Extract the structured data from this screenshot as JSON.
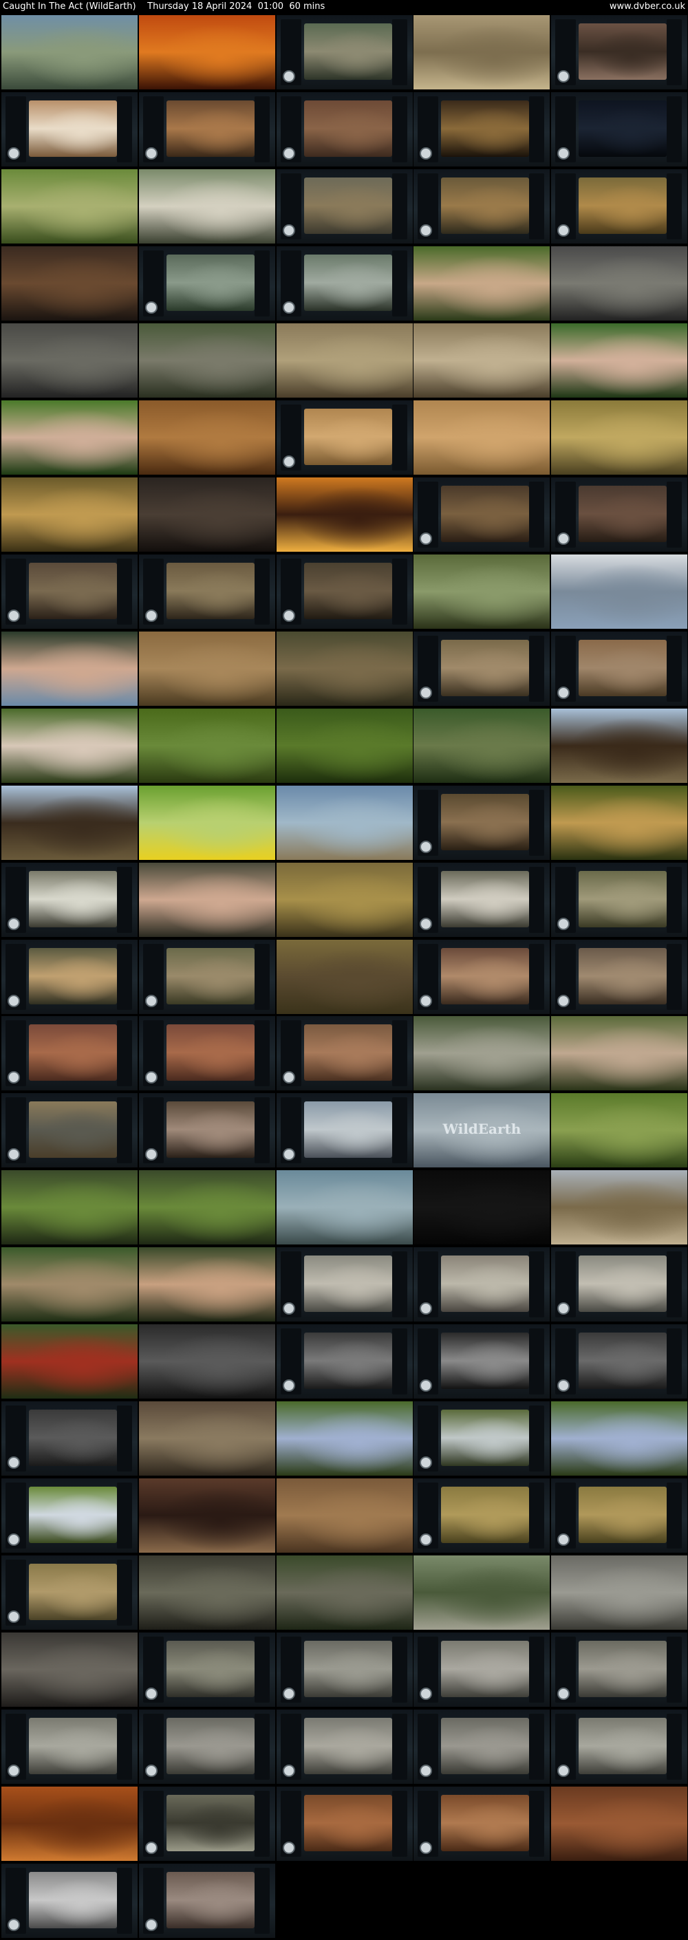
{
  "header": {
    "title": "Caught In The Act (WildEarth)    Thursday 18 April 2024  01:00  60 mins",
    "site": "www.dvber.co.uk"
  },
  "thumbnails": [
    {
      "kind": "photo",
      "palette": [
        "#6f8fa6",
        "#8a9a7a",
        "#3a4a3a"
      ],
      "caption": ""
    },
    {
      "kind": "photo",
      "palette": [
        "#c04a10",
        "#e07a20",
        "#3a1205"
      ],
      "caption": ""
    },
    {
      "kind": "ui",
      "palette": [
        "#5a6a52",
        "#8d8a72",
        "#2d3428"
      ],
      "caption": ""
    },
    {
      "kind": "photo",
      "palette": [
        "#a89774",
        "#7d6e4f",
        "#c5b48c"
      ],
      "caption": ""
    },
    {
      "kind": "ui",
      "palette": [
        "#6b5244",
        "#3a2d24",
        "#8a7060"
      ],
      "caption": ""
    },
    {
      "kind": "ui",
      "palette": [
        "#b8906a",
        "#e9dcc8",
        "#7a5a3a"
      ],
      "caption": ""
    },
    {
      "kind": "ui",
      "palette": [
        "#6a4a30",
        "#a9784a",
        "#3a2818"
      ],
      "caption": ""
    },
    {
      "kind": "ui",
      "palette": [
        "#6d4a36",
        "#8a6448",
        "#3d2a1f"
      ],
      "caption": ""
    },
    {
      "kind": "ui",
      "palette": [
        "#3a2a1a",
        "#8a6a3a",
        "#1a120a"
      ],
      "caption": ""
    },
    {
      "kind": "ui",
      "palette": [
        "#0e1420",
        "#1b2433",
        "#05080c"
      ],
      "caption": ""
    },
    {
      "kind": "photo",
      "palette": [
        "#6a8a3a",
        "#a8b070",
        "#384d1c"
      ],
      "caption": ""
    },
    {
      "kind": "photo",
      "palette": [
        "#7a8a6a",
        "#d4d0c0",
        "#3a4030"
      ],
      "caption": ""
    },
    {
      "kind": "ui",
      "palette": [
        "#6d6a58",
        "#8a7a5a",
        "#3d3a2e"
      ],
      "caption": ""
    },
    {
      "kind": "ui",
      "palette": [
        "#6a5a3a",
        "#9a7a4a",
        "#2e2a1c"
      ],
      "caption": ""
    },
    {
      "kind": "ui",
      "palette": [
        "#7a6a3a",
        "#b08a4a",
        "#4a3a1a"
      ],
      "caption": ""
    },
    {
      "kind": "photo",
      "palette": [
        "#3a2a20",
        "#6a4a30",
        "#1a1410"
      ],
      "caption": ""
    },
    {
      "kind": "ui",
      "palette": [
        "#5a6a5a",
        "#8a9a8a",
        "#2a3a2a"
      ],
      "caption": ""
    },
    {
      "kind": "ui",
      "palette": [
        "#6a7a6a",
        "#a0aaa0",
        "#2a3228"
      ],
      "caption": ""
    },
    {
      "kind": "photo",
      "palette": [
        "#4a6a2a",
        "#c8a888",
        "#2a3a18"
      ],
      "caption": ""
    },
    {
      "kind": "photo",
      "palette": [
        "#4a4a4a",
        "#7a7a72",
        "#222"
      ],
      "caption": ""
    },
    {
      "kind": "photo",
      "palette": [
        "#4a4a46",
        "#6a6a62",
        "#222"
      ],
      "caption": ""
    },
    {
      "kind": "photo",
      "palette": [
        "#4a5a3a",
        "#7a7a6a",
        "#2a3020"
      ],
      "caption": ""
    },
    {
      "kind": "photo",
      "palette": [
        "#8a7a5a",
        "#b0a07a",
        "#4a3e2a"
      ],
      "caption": ""
    },
    {
      "kind": "photo",
      "palette": [
        "#8a7a5a",
        "#c0b090",
        "#4a3e2a"
      ],
      "caption": ""
    },
    {
      "kind": "photo",
      "palette": [
        "#3a6a2a",
        "#d2b09a",
        "#1d3614"
      ],
      "caption": ""
    },
    {
      "kind": "photo",
      "palette": [
        "#4a7a2a",
        "#cfae98",
        "#1c3a12"
      ],
      "caption": ""
    },
    {
      "kind": "photo",
      "palette": [
        "#8a5a2a",
        "#b07a40",
        "#4a2a10"
      ],
      "caption": ""
    },
    {
      "kind": "ui",
      "palette": [
        "#b08650",
        "#d2a870",
        "#7a5a30"
      ],
      "caption": ""
    },
    {
      "kind": "photo",
      "palette": [
        "#b08650",
        "#d0a46c",
        "#7a5a30"
      ],
      "caption": ""
    },
    {
      "kind": "photo",
      "palette": [
        "#8a7a3a",
        "#c0a860",
        "#4a4020"
      ],
      "caption": ""
    },
    {
      "kind": "photo",
      "palette": [
        "#6a5a2a",
        "#c09a50",
        "#3a3014"
      ],
      "caption": ""
    },
    {
      "kind": "photo",
      "palette": [
        "#2a2420",
        "#4a3e34",
        "#120e0c"
      ],
      "caption": ""
    },
    {
      "kind": "photo",
      "palette": [
        "#d07a20",
        "#3a1e10",
        "#f0b040"
      ],
      "caption": ""
    },
    {
      "kind": "ui",
      "palette": [
        "#4a3a2a",
        "#7a6040",
        "#2a1e14"
      ],
      "caption": ""
    },
    {
      "kind": "ui",
      "palette": [
        "#4a3a30",
        "#6a5040",
        "#261c14"
      ],
      "caption": ""
    },
    {
      "kind": "ui",
      "palette": [
        "#5a4a3a",
        "#7a6a50",
        "#2a2018"
      ],
      "caption": ""
    },
    {
      "kind": "ui",
      "palette": [
        "#6a5a40",
        "#8a7a5a",
        "#2d251a"
      ],
      "caption": ""
    },
    {
      "kind": "ui",
      "palette": [
        "#4a4030",
        "#6a5a44",
        "#201a12"
      ],
      "caption": ""
    },
    {
      "kind": "photo",
      "palette": [
        "#5a6a3a",
        "#8a9a6a",
        "#2a3218"
      ],
      "caption": ""
    },
    {
      "kind": "photo",
      "palette": [
        "#d8dce0",
        "#7a8a9a",
        "#8aa0b8"
      ],
      "caption": ""
    },
    {
      "kind": "photo",
      "palette": [
        "#2a3a2a",
        "#cfa890",
        "#6a8aa8"
      ],
      "caption": ""
    },
    {
      "kind": "photo",
      "palette": [
        "#8a6a40",
        "#a8875a",
        "#4a3a20"
      ],
      "caption": ""
    },
    {
      "kind": "photo",
      "palette": [
        "#4a4a30",
        "#7a6a4a",
        "#2a2818"
      ],
      "caption": ""
    },
    {
      "kind": "ui",
      "palette": [
        "#7a6a4a",
        "#a08a6a",
        "#3a3020"
      ],
      "caption": ""
    },
    {
      "kind": "ui",
      "palette": [
        "#8a6a4a",
        "#a0866a",
        "#4a3a24"
      ],
      "caption": ""
    },
    {
      "kind": "photo",
      "palette": [
        "#4a6a2a",
        "#d8c8b8",
        "#2a3a16"
      ],
      "caption": ""
    },
    {
      "kind": "photo",
      "palette": [
        "#4a6a1a",
        "#6a8a3a",
        "#2a3a10"
      ],
      "caption": ""
    },
    {
      "kind": "photo",
      "palette": [
        "#3a5a1a",
        "#5a7a2a",
        "#1d2e0c"
      ],
      "caption": ""
    },
    {
      "kind": "photo",
      "palette": [
        "#3a5a2a",
        "#6a7a4a",
        "#1e2e14"
      ],
      "caption": ""
    },
    {
      "kind": "photo",
      "palette": [
        "#a8c0d8",
        "#3a2a1a",
        "#7a6a4a"
      ],
      "caption": ""
    },
    {
      "kind": "photo",
      "palette": [
        "#aac2da",
        "#3a2c1e",
        "#6a5a3a"
      ],
      "caption": ""
    },
    {
      "kind": "photo",
      "palette": [
        "#6aa030",
        "#b8d070",
        "#e8d020"
      ],
      "caption": ""
    },
    {
      "kind": "photo",
      "palette": [
        "#6a8aaa",
        "#a0b8c8",
        "#8a7a5a"
      ],
      "caption": ""
    },
    {
      "kind": "ui",
      "palette": [
        "#5a4a30",
        "#8a7050",
        "#2a2014"
      ],
      "caption": ""
    },
    {
      "kind": "photo",
      "palette": [
        "#4a5a1a",
        "#c09a50",
        "#2a3210"
      ],
      "caption": ""
    },
    {
      "kind": "ui",
      "palette": [
        "#7a7a6a",
        "#d8d8cc",
        "#3a3a30"
      ],
      "caption": ""
    },
    {
      "kind": "photo",
      "palette": [
        "#4a4a3a",
        "#cea890",
        "#2a2a20"
      ],
      "caption": ""
    },
    {
      "kind": "photo",
      "palette": [
        "#7a6a3a",
        "#a8904a",
        "#3a321a"
      ],
      "caption": ""
    },
    {
      "kind": "ui",
      "palette": [
        "#6a6a5a",
        "#d0ccc0",
        "#3a3a30"
      ],
      "caption": ""
    },
    {
      "kind": "ui",
      "palette": [
        "#6a6a4a",
        "#a09a7a",
        "#3a3a24"
      ],
      "caption": ""
    },
    {
      "kind": "ui",
      "palette": [
        "#5a5a40",
        "#c0a070",
        "#2e2e20"
      ],
      "caption": ""
    },
    {
      "kind": "ui",
      "palette": [
        "#6a6a4a",
        "#9a8a6a",
        "#3a3a24"
      ],
      "caption": ""
    },
    {
      "kind": "photo",
      "palette": [
        "#7a6a3a",
        "#5a4a30",
        "#3a321a"
      ],
      "caption": ""
    },
    {
      "kind": "ui",
      "palette": [
        "#6a4a3a",
        "#b08a6a",
        "#3a2a1e"
      ],
      "caption": ""
    },
    {
      "kind": "ui",
      "palette": [
        "#6a5a4a",
        "#a08a70",
        "#3a2e22"
      ],
      "caption": ""
    },
    {
      "kind": "ui",
      "palette": [
        "#7a4a3a",
        "#a86a4a",
        "#4a2a1e"
      ],
      "caption": ""
    },
    {
      "kind": "ui",
      "palette": [
        "#7a4a3a",
        "#a86a4a",
        "#4a2a1e"
      ],
      "caption": ""
    },
    {
      "kind": "ui",
      "palette": [
        "#7a5a40",
        "#a87a5a",
        "#4a3020"
      ],
      "caption": ""
    },
    {
      "kind": "photo",
      "palette": [
        "#4a5a3a",
        "#a0a090",
        "#2a3220"
      ],
      "caption": ""
    },
    {
      "kind": "photo",
      "palette": [
        "#5a6a3a",
        "#c0a890",
        "#2a3418"
      ],
      "caption": ""
    },
    {
      "kind": "ui",
      "palette": [
        "#8a7a5a",
        "#5a5a50",
        "#4a3e2a"
      ],
      "caption": ""
    },
    {
      "kind": "ui",
      "palette": [
        "#5a4a3a",
        "#a08a7a",
        "#2a2018"
      ],
      "caption": ""
    },
    {
      "kind": "ui",
      "palette": [
        "#8a9aa8",
        "#c0c8cc",
        "#4a5058"
      ],
      "caption": ""
    },
    {
      "kind": "photo",
      "palette": [
        "#7a8a94",
        "#aab6bc",
        "#4a5660"
      ],
      "caption": "WildEarth"
    },
    {
      "kind": "photo",
      "palette": [
        "#5a7a2a",
        "#8aa050",
        "#2a3e14"
      ],
      "caption": ""
    },
    {
      "kind": "photo",
      "palette": [
        "#3a4a2a",
        "#6a8a3a",
        "#1e2814"
      ],
      "caption": ""
    },
    {
      "kind": "photo",
      "palette": [
        "#3a4a2a",
        "#6a8a3a",
        "#1e2814"
      ],
      "caption": ""
    },
    {
      "kind": "photo",
      "palette": [
        "#6a8a9a",
        "#9ab0b8",
        "#3a4a4a"
      ],
      "caption": ""
    },
    {
      "kind": "photo",
      "palette": [
        "#0a0a0a",
        "#151515",
        "#050505"
      ],
      "caption": ""
    },
    {
      "kind": "photo",
      "palette": [
        "#a8b0b8",
        "#7a6a4a",
        "#c0b090"
      ],
      "caption": ""
    },
    {
      "kind": "photo",
      "palette": [
        "#3a5a2a",
        "#a08a6a",
        "#1e2e14"
      ],
      "caption": ""
    },
    {
      "kind": "photo",
      "palette": [
        "#3a4a2a",
        "#c8a080",
        "#1e2614"
      ],
      "caption": ""
    },
    {
      "kind": "ui",
      "palette": [
        "#8a8a80",
        "#c0bcb0",
        "#4a4a44"
      ],
      "caption": ""
    },
    {
      "kind": "ui",
      "palette": [
        "#8a8478",
        "#bcb8aa",
        "#4a4640"
      ],
      "caption": ""
    },
    {
      "kind": "ui",
      "palette": [
        "#8a8a80",
        "#c2beb2",
        "#4a4a44"
      ],
      "caption": ""
    },
    {
      "kind": "photo",
      "palette": [
        "#3a5a2a",
        "#a03020",
        "#1e2e14"
      ],
      "caption": ""
    },
    {
      "kind": "photo",
      "palette": [
        "#2a2a2a",
        "#5a5a5a",
        "#121212"
      ],
      "caption": ""
    },
    {
      "kind": "ui",
      "palette": [
        "#3a3a3a",
        "#7a7a7a",
        "#1a1a1a"
      ],
      "caption": ""
    },
    {
      "kind": "ui",
      "palette": [
        "#2a2a2a",
        "#8a8a8a",
        "#121212"
      ],
      "caption": ""
    },
    {
      "kind": "ui",
      "palette": [
        "#3a3a3a",
        "#6a6a6a",
        "#1a1a1a"
      ],
      "caption": ""
    },
    {
      "kind": "ui",
      "palette": [
        "#3a3a3a",
        "#5a5a5a",
        "#1a1a1a"
      ],
      "caption": ""
    },
    {
      "kind": "photo",
      "palette": [
        "#5a4a3a",
        "#8a7a60",
        "#2e261c"
      ],
      "caption": ""
    },
    {
      "kind": "photo",
      "palette": [
        "#4a6a2a",
        "#a0b0d0",
        "#2a3a16"
      ],
      "caption": ""
    },
    {
      "kind": "ui",
      "palette": [
        "#5a6a3a",
        "#c0c8c8",
        "#2e3620"
      ],
      "caption": ""
    },
    {
      "kind": "photo",
      "palette": [
        "#4a6a2a",
        "#a0b0d0",
        "#2a3a16"
      ],
      "caption": ""
    },
    {
      "kind": "ui",
      "palette": [
        "#6a8a3a",
        "#d0d8e0",
        "#3a4a1e"
      ],
      "caption": ""
    },
    {
      "kind": "photo",
      "palette": [
        "#5a3a2a",
        "#2a1a14",
        "#8a6a4a"
      ],
      "caption": ""
    },
    {
      "kind": "photo",
      "palette": [
        "#7a5a3a",
        "#a07a50",
        "#4a3420"
      ],
      "caption": ""
    },
    {
      "kind": "ui",
      "palette": [
        "#8a7a40",
        "#b09a5a",
        "#4a421e"
      ],
      "caption": ""
    },
    {
      "kind": "ui",
      "palette": [
        "#8a7a40",
        "#b0985a",
        "#4a421e"
      ],
      "caption": ""
    },
    {
      "kind": "ui",
      "palette": [
        "#8a7a4a",
        "#b09a6a",
        "#4a4226"
      ],
      "caption": ""
    },
    {
      "kind": "photo",
      "palette": [
        "#3a3a30",
        "#6a6a5a",
        "#1e1e18"
      ],
      "caption": ""
    },
    {
      "kind": "photo",
      "palette": [
        "#3a4a2a",
        "#6a6a5a",
        "#1e2616"
      ],
      "caption": ""
    },
    {
      "kind": "photo",
      "palette": [
        "#7a8a6a",
        "#4a5a3a",
        "#a0a090"
      ],
      "caption": ""
    },
    {
      "kind": "photo",
      "palette": [
        "#6a6a64",
        "#9a9a92",
        "#3a3a34"
      ],
      "caption": ""
    },
    {
      "kind": "photo",
      "palette": [
        "#3a3834",
        "#6a665e",
        "#1e1c1a"
      ],
      "caption": ""
    },
    {
      "kind": "ui",
      "palette": [
        "#5a5a50",
        "#8a8a7a",
        "#2e2e28"
      ],
      "caption": ""
    },
    {
      "kind": "ui",
      "palette": [
        "#6a6a62",
        "#9a9a90",
        "#3a3a34"
      ],
      "caption": ""
    },
    {
      "kind": "ui",
      "palette": [
        "#7a7a70",
        "#aaa8a0",
        "#3e3e38"
      ],
      "caption": ""
    },
    {
      "kind": "ui",
      "palette": [
        "#6a6a60",
        "#9c9a90",
        "#3a3a34"
      ],
      "caption": ""
    },
    {
      "kind": "ui",
      "palette": [
        "#7a7a70",
        "#a8a89e",
        "#3e3e38"
      ],
      "caption": ""
    },
    {
      "kind": "ui",
      "palette": [
        "#6a6a62",
        "#9a9890",
        "#3a3a34"
      ],
      "caption": ""
    },
    {
      "kind": "ui",
      "palette": [
        "#7a7a72",
        "#aaa89e",
        "#3e3e38"
      ],
      "caption": ""
    },
    {
      "kind": "ui",
      "palette": [
        "#6a6a62",
        "#9a9890",
        "#3a3a34"
      ],
      "caption": ""
    },
    {
      "kind": "ui",
      "palette": [
        "#7a7a70",
        "#a8a89e",
        "#3e3e38"
      ],
      "caption": ""
    },
    {
      "kind": "photo",
      "palette": [
        "#a8501a",
        "#6a3010",
        "#d07a30"
      ],
      "caption": ""
    },
    {
      "kind": "ui",
      "palette": [
        "#6a6a5a",
        "#3a3a30",
        "#9a9a88"
      ],
      "caption": ""
    },
    {
      "kind": "ui",
      "palette": [
        "#7a4a2a",
        "#a86a40",
        "#4a2a16"
      ],
      "caption": ""
    },
    {
      "kind": "ui",
      "palette": [
        "#7a4a2a",
        "#b07a50",
        "#4a2a16"
      ],
      "caption": ""
    },
    {
      "kind": "photo",
      "palette": [
        "#6a3a20",
        "#9a5a34",
        "#3a1e10"
      ],
      "caption": ""
    },
    {
      "kind": "ui",
      "palette": [
        "#8a8a8a",
        "#c8c8c8",
        "#4a4a4a"
      ],
      "caption": ""
    },
    {
      "kind": "ui",
      "palette": [
        "#6a5a50",
        "#9a8a80",
        "#3a2e28"
      ],
      "caption": ""
    }
  ]
}
